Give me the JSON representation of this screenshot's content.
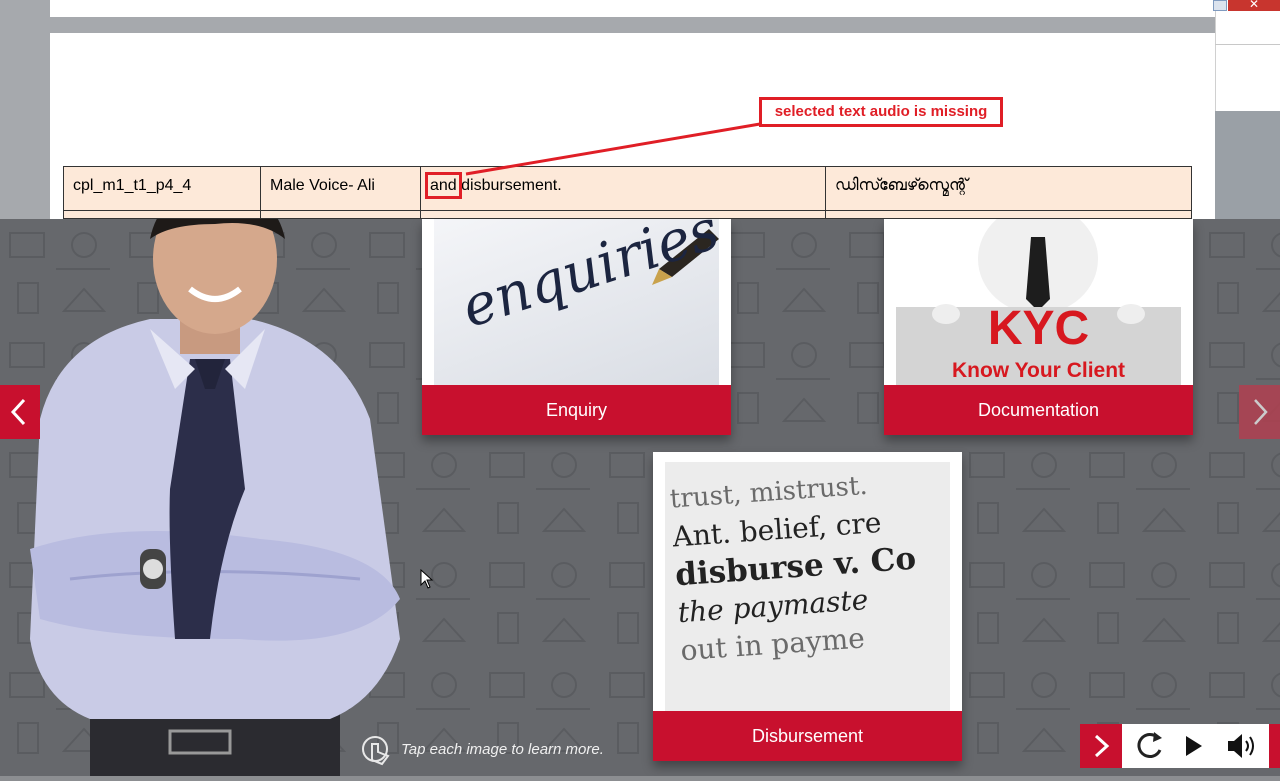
{
  "document": {
    "annotation": "selected text audio is missing",
    "row": {
      "id": "cpl_m1_t1_p4_4",
      "voice": "Male Voice- Ali",
      "text_highlight": "and",
      "text_rest": " disbursement.",
      "translation": "ഡിസ്ബേഴ്സ്മെന്റ്"
    }
  },
  "window": {
    "close_glyph": "✕"
  },
  "player": {
    "cards": [
      {
        "label": "Enquiry",
        "image_text": "enquiries"
      },
      {
        "label": "Documentation",
        "image_text_1": "KYC",
        "image_text_2": "Know Your Client"
      },
      {
        "label": "Disbursement",
        "image_lines": [
          "trust, mistrust.",
          "Ant. belief, cre",
          "disburse v. Co",
          "the paymaste",
          "out in payme"
        ]
      }
    ],
    "hint": "Tap each image to learn more.",
    "controls": {
      "next_icon": "chevron-right-icon",
      "replay_icon": "replay-icon",
      "play_icon": "play-icon",
      "volume_icon": "volume-icon"
    },
    "accent_color": "#c8102e"
  }
}
